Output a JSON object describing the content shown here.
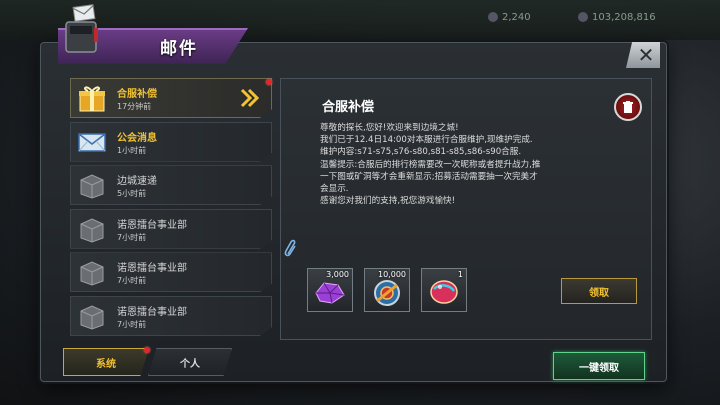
{
  "window": {
    "title": "邮件"
  },
  "hud": {
    "res_a": "2,240",
    "res_b": "103,208,816"
  },
  "mail_list": [
    {
      "name": "合服补偿",
      "time": "17分钟前",
      "style": "gold",
      "icon": "gift-icon",
      "unread": true
    },
    {
      "name": "公会消息",
      "time": "1小时前",
      "style": "gold",
      "icon": "envelope-icon",
      "unread": false
    },
    {
      "name": "边城速递",
      "time": "5小时前",
      "style": "grey",
      "icon": "package-icon",
      "unread": false
    },
    {
      "name": "诺恩擂台事业部",
      "time": "7小时前",
      "style": "grey",
      "icon": "package-icon",
      "unread": false
    },
    {
      "name": "诺恩擂台事业部",
      "time": "7小时前",
      "style": "grey",
      "icon": "package-icon",
      "unread": false
    },
    {
      "name": "诺恩擂台事业部",
      "time": "7小时前",
      "style": "grey",
      "icon": "package-icon",
      "unread": false
    }
  ],
  "detail": {
    "title": "合服补偿",
    "lines": [
      "尊敬的探长,您好!欢迎来到边境之城!",
      "我们已于12.4日14:00对本服进行合服维护,现维护完成.",
      "维护内容:s71-s75,s76-s80,s81-s85,s86-s90合服.",
      "温馨提示:合服后的排行榜需要改一次昵称或者提升战力,推",
      "一下图或矿洞等才会重新显示;招募活动需要抽一次完美才",
      "会显示.",
      "感谢您对我们的支持,祝您游戏愉快!"
    ],
    "rewards": [
      {
        "count": "3,000",
        "icon": "purple-gem-icon"
      },
      {
        "count": "10,000",
        "icon": "gear-coin-icon"
      },
      {
        "count": "1",
        "icon": "red-orb-icon"
      }
    ],
    "claim_label": "领取"
  },
  "tabs": {
    "system": "系统",
    "personal": "个人"
  },
  "claim_all_label": "一键领取",
  "colors": {
    "gold": "#f2c230",
    "accent_purple": "#6a3c86",
    "green": "#5fd38a",
    "red_dot": "#e02828"
  }
}
